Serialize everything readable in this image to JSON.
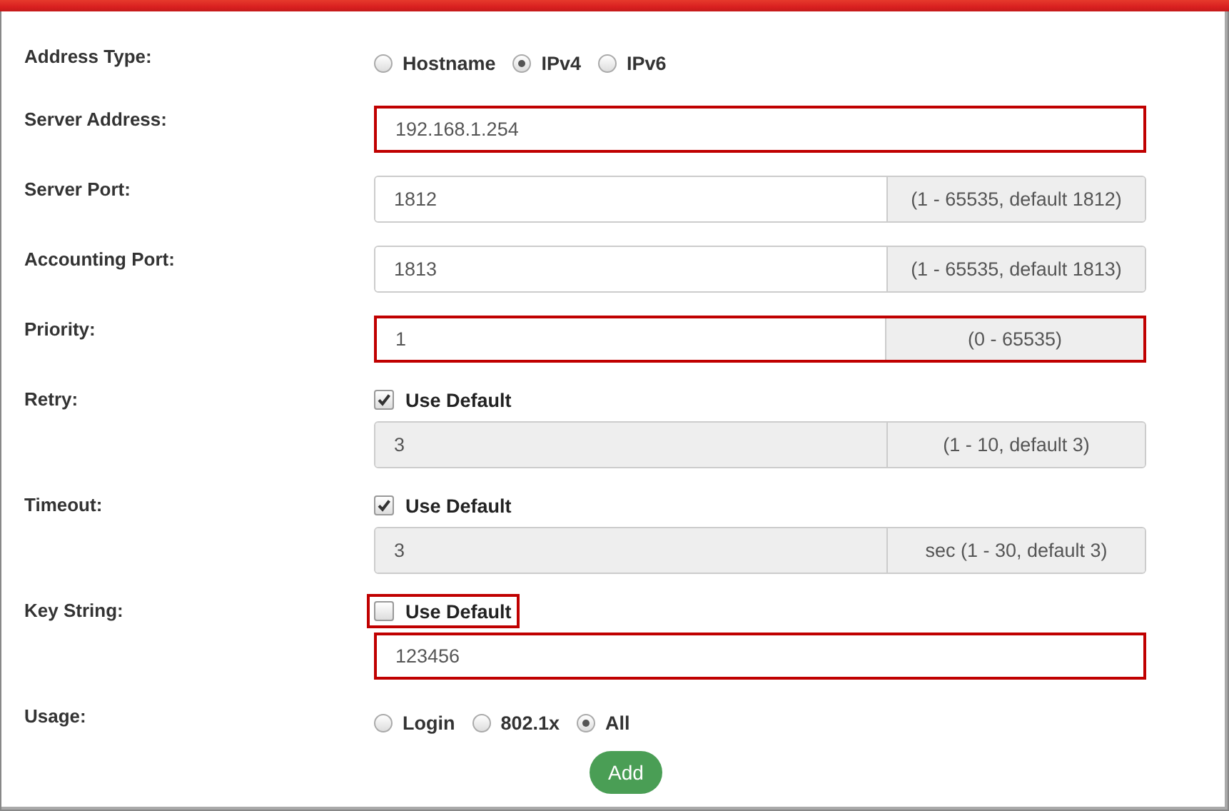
{
  "rows": [
    {
      "kind": "radios",
      "label": "Address Type:",
      "options": [
        {
          "label": "Hostname",
          "selected": false
        },
        {
          "label": "IPv4",
          "selected": true
        },
        {
          "label": "IPv6",
          "selected": false
        }
      ]
    },
    {
      "kind": "field",
      "label": "Server Address:",
      "value": "192.168.1.254",
      "highlighted": true,
      "disabled": false
    },
    {
      "kind": "field",
      "label": "Server Port:",
      "value": "1812",
      "hint": "(1 - 65535, default 1812)",
      "highlighted": false,
      "disabled": false
    },
    {
      "kind": "field",
      "label": "Accounting Port:",
      "value": "1813",
      "hint": "(1 - 65535, default 1813)",
      "highlighted": false,
      "disabled": false
    },
    {
      "kind": "field",
      "label": "Priority:",
      "value": "1",
      "hint": "(0 - 65535)",
      "highlighted": true,
      "disabled": false
    },
    {
      "kind": "check_field",
      "label": "Retry:",
      "checkbox": {
        "label": "Use Default",
        "checked": true,
        "highlighted": false
      },
      "value": "3",
      "hint": "(1 - 10, default 3)",
      "highlighted": false,
      "disabled": true
    },
    {
      "kind": "check_field",
      "label": "Timeout:",
      "checkbox": {
        "label": "Use Default",
        "checked": true,
        "highlighted": false
      },
      "value": "3",
      "hint": "sec (1 - 30, default 3)",
      "highlighted": false,
      "disabled": true
    },
    {
      "kind": "check_field",
      "label": "Key String:",
      "checkbox": {
        "label": "Use Default",
        "checked": false,
        "highlighted": true
      },
      "value": "123456",
      "highlighted": true,
      "disabled": false
    },
    {
      "kind": "radios",
      "label": "Usage:",
      "options": [
        {
          "label": "Login",
          "selected": false
        },
        {
          "label": "802.1x",
          "selected": false
        },
        {
          "label": "All",
          "selected": true
        }
      ]
    }
  ],
  "button": {
    "label": "Add"
  }
}
